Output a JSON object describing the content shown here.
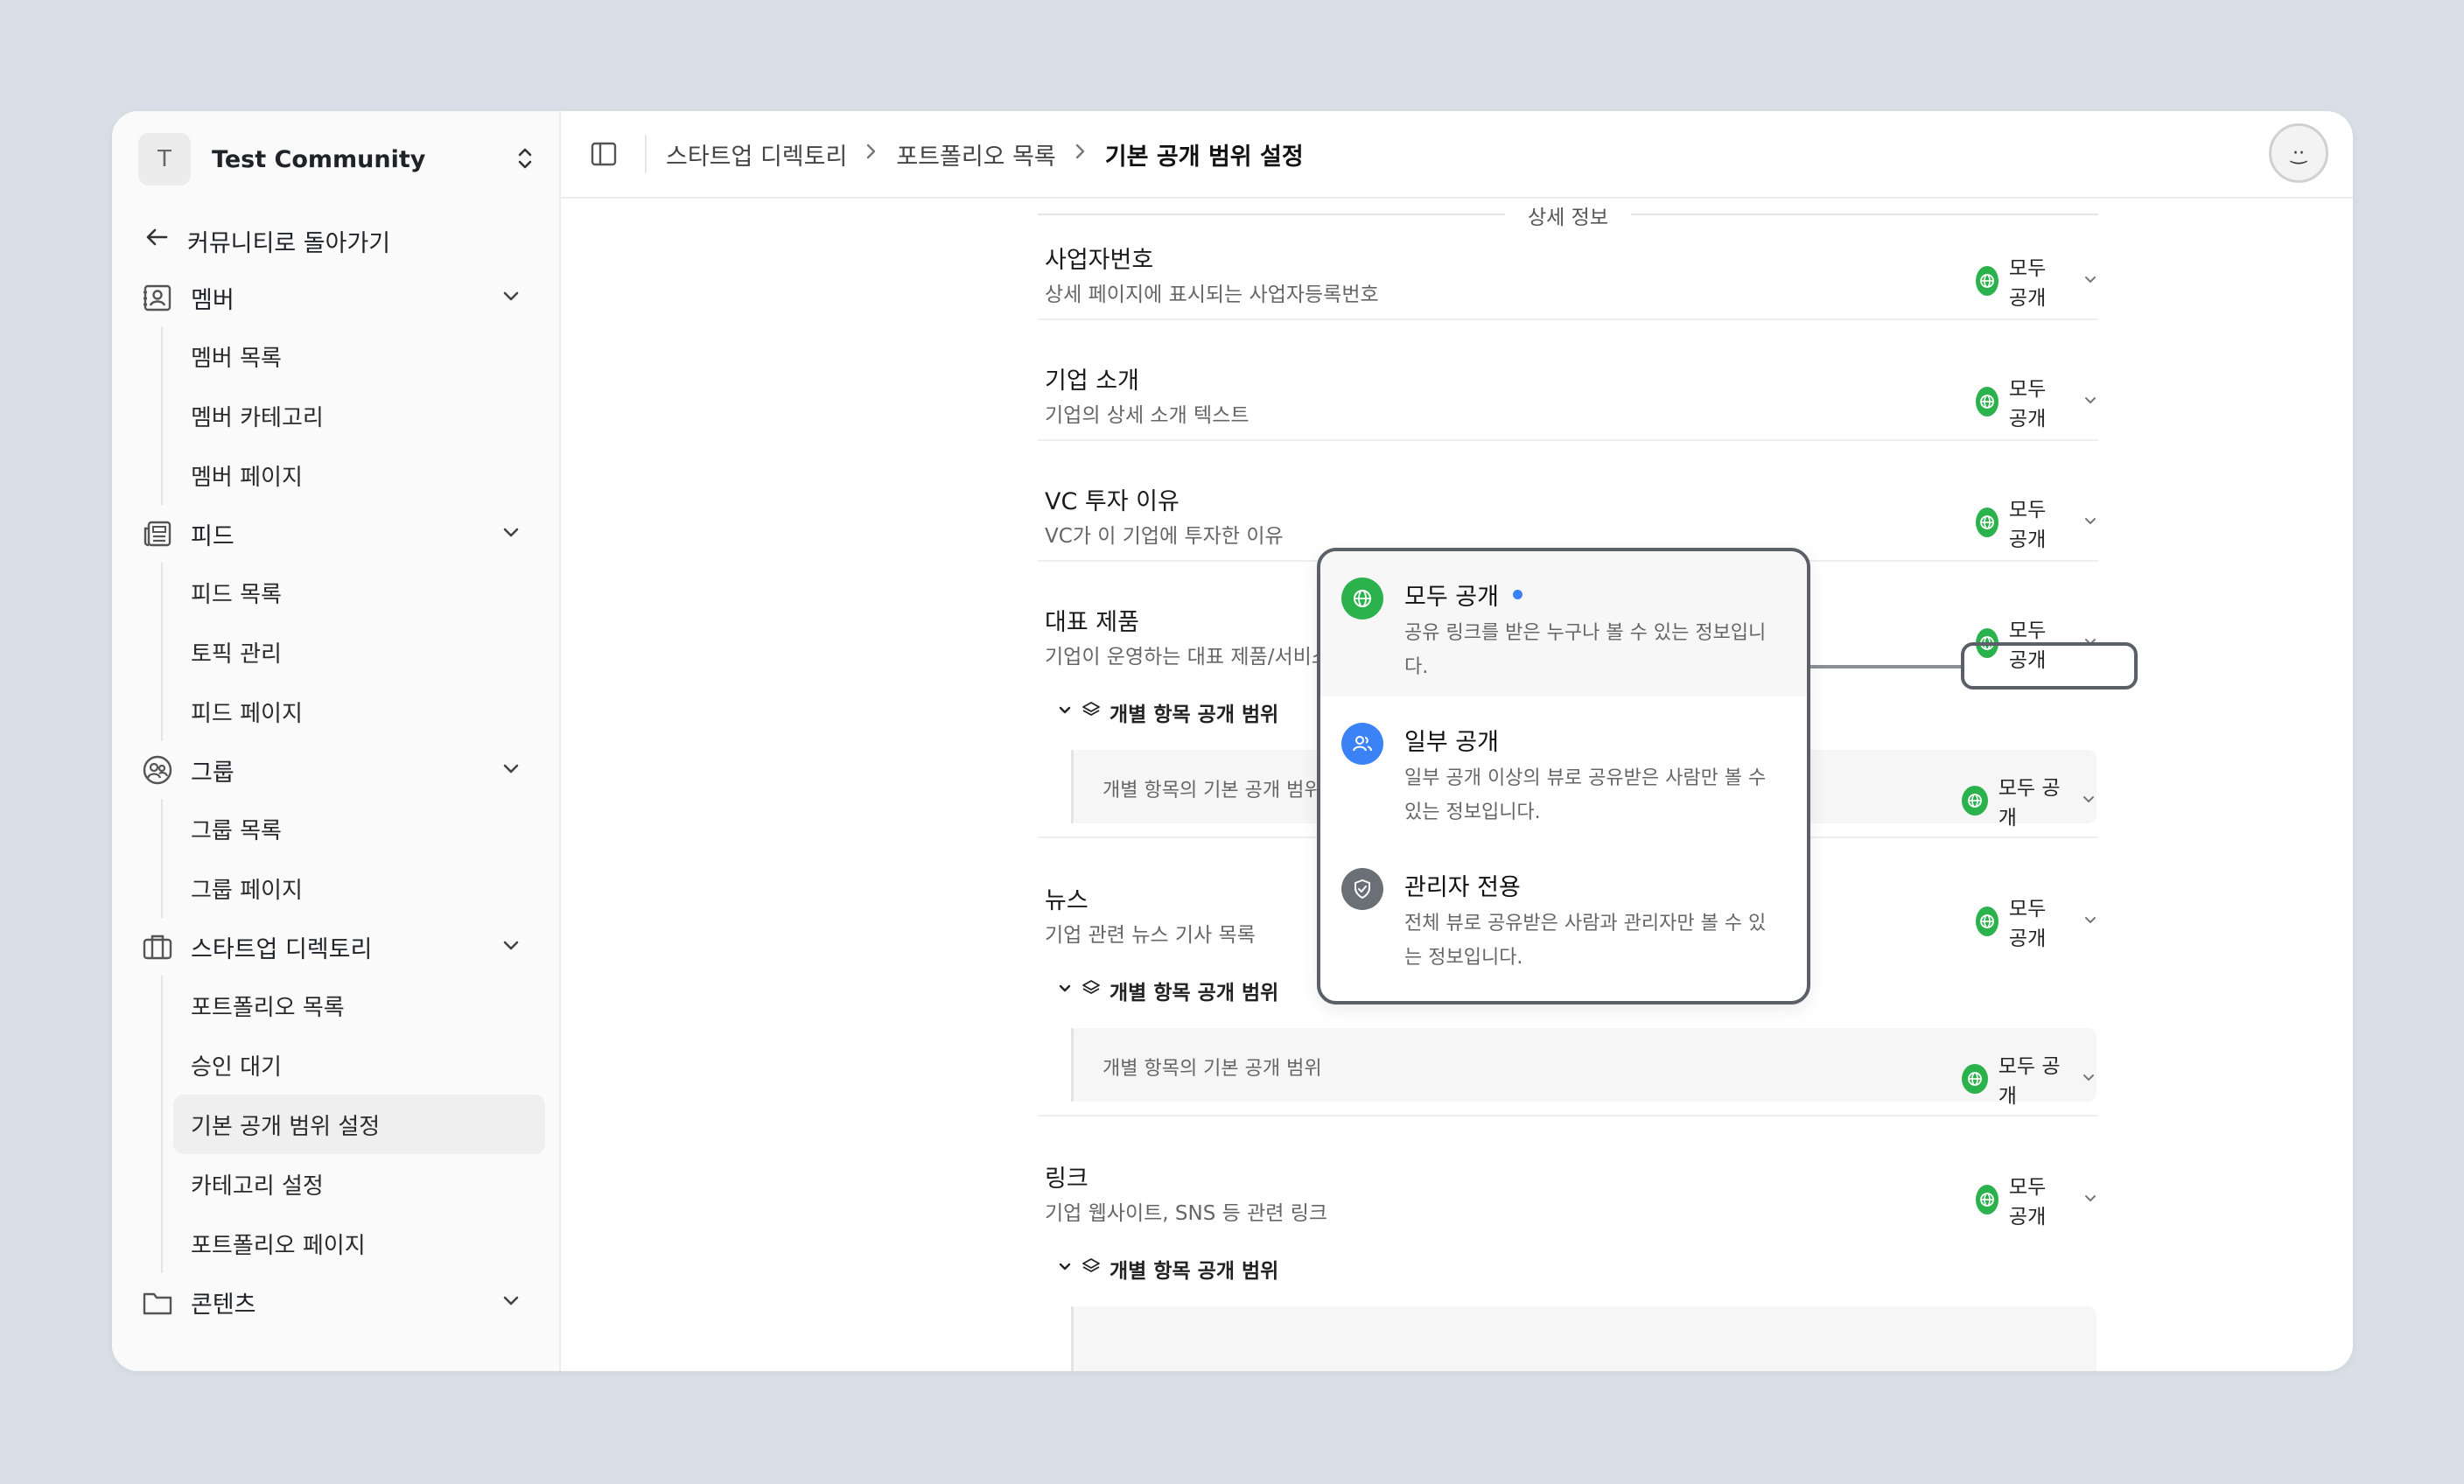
{
  "workspace": {
    "initial": "T",
    "name": "Test Community"
  },
  "sidebar": {
    "back_label": "커뮤니티로 돌아가기",
    "groups": [
      {
        "label": "멤버",
        "icon": "member-icon",
        "items": [
          "멤버 목록",
          "멤버 카테고리",
          "멤버 페이지"
        ]
      },
      {
        "label": "피드",
        "icon": "feed-icon",
        "items": [
          "피드 목록",
          "토픽 관리",
          "피드 페이지"
        ]
      },
      {
        "label": "그룹",
        "icon": "group-icon",
        "items": [
          "그룹 목록",
          "그룹 페이지"
        ]
      },
      {
        "label": "스타트업 디렉토리",
        "icon": "briefcase-icon",
        "items": [
          "포트폴리오 목록",
          "승인 대기",
          "기본 공개 범위 설정",
          "카테고리 설정",
          "포트폴리오 페이지"
        ]
      },
      {
        "label": "콘텐츠",
        "icon": "folder-icon",
        "items": []
      }
    ],
    "active_item": "기본 공개 범위 설정"
  },
  "breadcrumb": [
    "스타트업 디렉토리",
    "포트폴리오 목록",
    "기본 공개 범위 설정"
  ],
  "user": {
    "avatar_glyph": "·͜·"
  },
  "section_title": "상세 정보",
  "visibility_label": "모두 공개",
  "sub_toggle_label": "개별 항목 공개 범위",
  "item_box_label": "개별 항목의 기본 공개 범위",
  "fields": [
    {
      "title": "사업자번호",
      "desc": "상세 페이지에 표시되는 사업자등록번호"
    },
    {
      "title": "기업 소개",
      "desc": "기업의 상세 소개 텍스트"
    },
    {
      "title": "VC 투자 이유",
      "desc": "VC가 이 기업에 투자한 이유"
    },
    {
      "title": "대표 제품",
      "desc": "기업이 운영하는 대표 제품/서비스"
    },
    {
      "title": "뉴스",
      "desc": "기업 관련 뉴스 기사 목록"
    },
    {
      "title": "링크",
      "desc": "기업 웹사이트, SNS 등 관련 링크"
    }
  ],
  "dropdown": {
    "options": [
      {
        "label": "모두 공개",
        "desc": "공유 링크를 받은 누구나 볼 수 있는 정보입니다.",
        "color": "#2bb24c",
        "icon": "globe-icon",
        "selected": true
      },
      {
        "label": "일부 공개",
        "desc": "일부 공개 이상의 뷰로 공유받은 사람만 볼 수 있는 정보입니다.",
        "color": "#3b82f6",
        "icon": "users-icon",
        "selected": false
      },
      {
        "label": "관리자 전용",
        "desc": "전체 뷰로 공유받은 사람과 관리자만 볼 수 있는 정보입니다.",
        "color": "#6b6f76",
        "icon": "shield-icon",
        "selected": false
      }
    ]
  },
  "colors": {
    "public": "#2bb24c",
    "partial": "#3b82f6",
    "admin": "#6b6f76",
    "background": "#d8dfe6"
  }
}
